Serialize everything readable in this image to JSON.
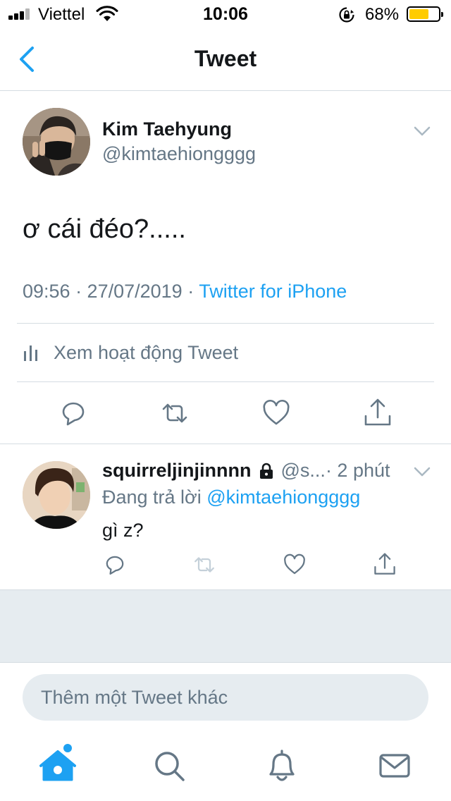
{
  "status_bar": {
    "carrier": "Viettel",
    "time": "10:06",
    "battery_percent": "68%",
    "battery_level": 0.68,
    "icons": [
      "signal-icon",
      "wifi-icon",
      "rotation-lock-icon",
      "battery-icon"
    ]
  },
  "nav": {
    "title": "Tweet",
    "back_icon": "chevron-left-icon"
  },
  "tweet": {
    "author_name": "Kim Taehyung",
    "author_handle": "@kimtaehiongggg",
    "text": "ơ cái đéo?.....",
    "time_date": "09:56 · 27/07/2019 · ",
    "source": "Twitter for iPhone",
    "activity_label": "Xem hoạt động Tweet",
    "actions": [
      "reply-icon",
      "retweet-icon",
      "like-icon",
      "share-icon"
    ]
  },
  "reply": {
    "author_name": "squirreljinjinnnn",
    "author_handle": "@s...",
    "time_ago": " · 2 phút",
    "replying_prefix": "Đang trả lời ",
    "replying_to": "@kimtaehiongggg",
    "text": "gì z?"
  },
  "compose": {
    "placeholder": "Thêm một Tweet khác"
  },
  "tab_bar": {
    "items": [
      "home-icon",
      "search-icon",
      "notifications-icon",
      "messages-icon"
    ]
  },
  "colors": {
    "accent": "#1da1f2",
    "secondary_text": "#657786",
    "primary_text": "#14171a",
    "divider": "#d5dce2",
    "background_gray": "#e6ecf0",
    "battery": "#ffcc00"
  }
}
